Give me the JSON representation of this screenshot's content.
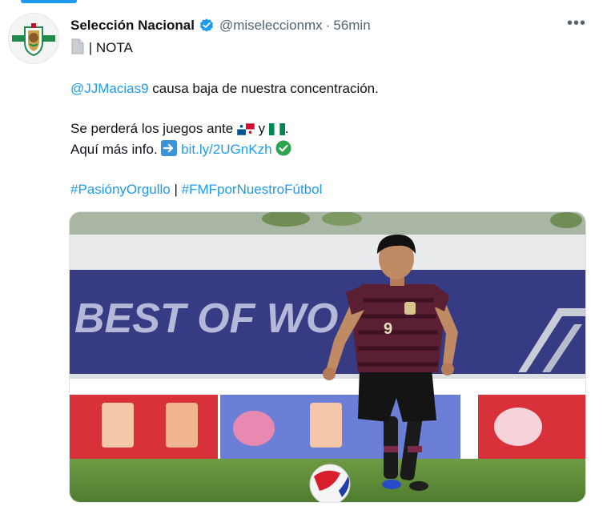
{
  "tweet": {
    "author_name": "Selección Nacional",
    "handle": "@miseleccionmx",
    "separator": "·",
    "time": "56min",
    "more_label": "•••",
    "nota_label": "| NOTA",
    "mention": "@JJMacias9",
    "line1_rest": " causa baja de nuestra concentración.",
    "line2_text": "Se perderá los juegos ante",
    "line2_and": " y ",
    "line2_end": ".",
    "line3_text": "Aquí más info.",
    "link_text": "bit.ly/2UGnKzh",
    "hashtag1": "#PasiónyOrgullo",
    "hashtag_sep": " | ",
    "hashtag2": "#FMFporNuestroFútbol",
    "image": {
      "banner_text": "BEST OF WO",
      "jersey_number": "9"
    }
  },
  "colors": {
    "link": "#1d9bf0",
    "verified": "#1d9bf0",
    "secondary_text": "#536471",
    "check_green": "#2da44e",
    "jersey_burgundy": "#5b1f33",
    "pitch_green": "#5c8f3a"
  },
  "icons": [
    "verified-badge-icon",
    "document-icon",
    "arrow-right-icon",
    "check-icon",
    "panama-flag-icon",
    "nigeria-flag-icon",
    "more-options-icon"
  ]
}
